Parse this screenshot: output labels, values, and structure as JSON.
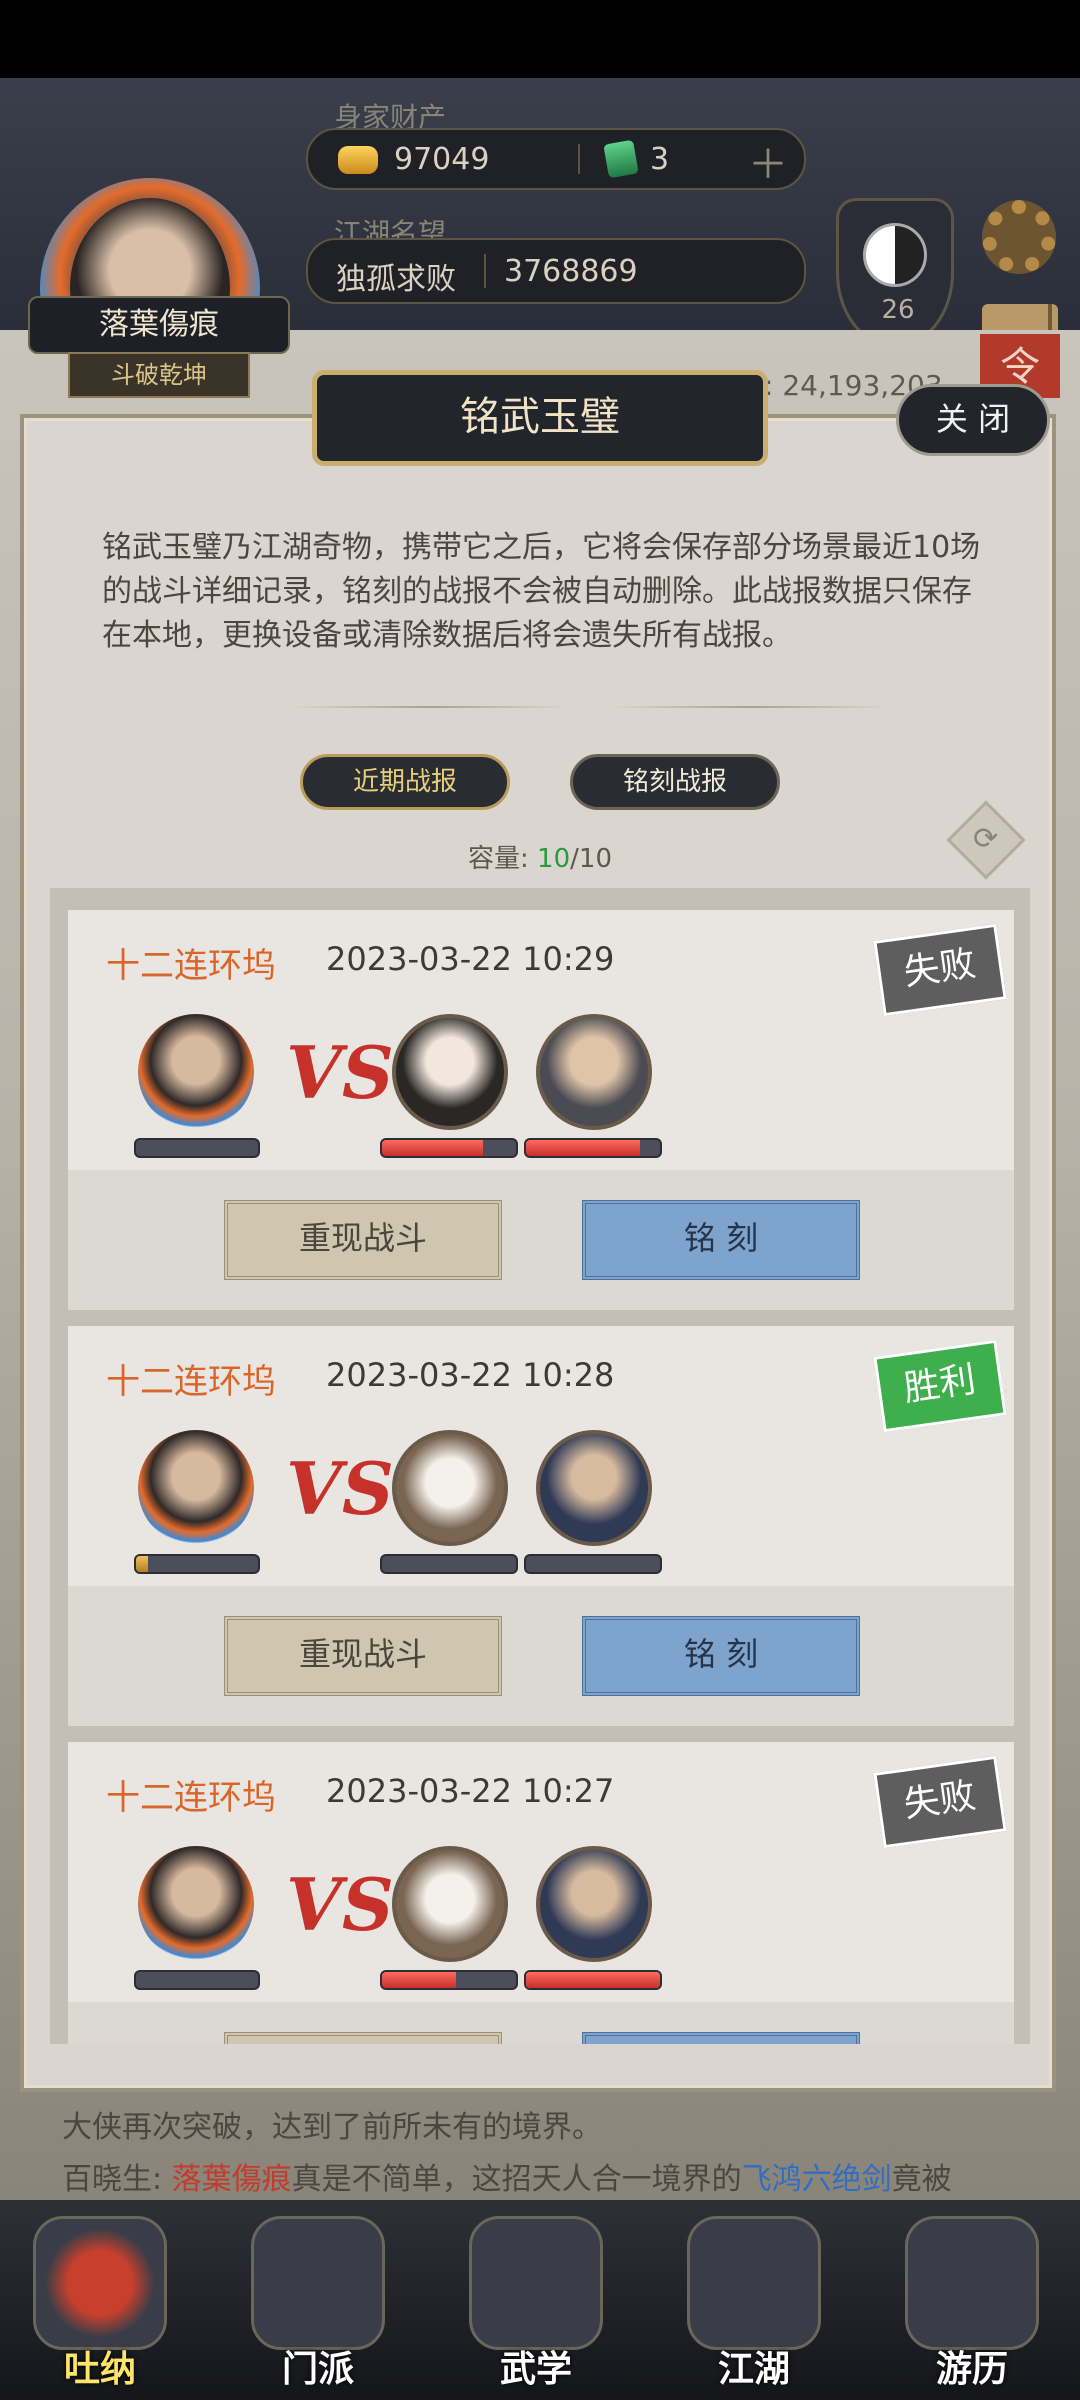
{
  "header": {
    "player_name": "落葉傷痕",
    "player_title": "斗破乾坤",
    "wealth_label": "身家财产",
    "gold": "97049",
    "jade": "3",
    "fame_label": "江湖名望",
    "fame_title": "独孤求败",
    "fame_value": "3768869",
    "level": "26",
    "bg_stat": "性: 24,193,203",
    "corner_tag": "令",
    "gender_symbol": "♂"
  },
  "dialog": {
    "title": "铭武玉璧",
    "close_label": "关 闭",
    "description": "铭武玉璧乃江湖奇物，携带它之后，它将会保存部分场景最近10场的战斗详细记录，铭刻的战报不会被自动删除。此战报数据只保存在本地，更换设备或清除数据后将会遗失所有战报。",
    "tabs": [
      {
        "label": "近期战报",
        "active": true
      },
      {
        "label": "铭刻战报",
        "active": false
      }
    ],
    "capacity_label": "容量: ",
    "capacity_used": "10",
    "capacity_total": "/10",
    "vs_label": "VS",
    "replay_label": "重现战斗",
    "engrave_label": "铭 刻"
  },
  "battles": [
    {
      "location": "十二连环坞",
      "time": "2023-03-22 10:29",
      "result": "失败",
      "result_color": "#5e5e5e",
      "player_hp": 0,
      "enemy_hp": [
        0.75,
        0.85
      ]
    },
    {
      "location": "十二连环坞",
      "time": "2023-03-22 10:28",
      "result": "胜利",
      "result_color": "#3fae4c",
      "player_hp": 0.1,
      "enemy_hp": [
        0,
        0
      ]
    },
    {
      "location": "十二连环坞",
      "time": "2023-03-22 10:27",
      "result": "失败",
      "result_color": "#5e5e5e",
      "player_hp": 0,
      "enemy_hp": [
        0.55,
        1.0
      ]
    }
  ],
  "chat": {
    "line1": "大侠再次突破，达到了前所未有的境界。",
    "speaker": "百晓生: ",
    "name": "落葉傷痕",
    "mid": "真是不简单，这招天人合一境界的",
    "skill": "飞鸿六绝剑",
    "end": "竟被"
  },
  "nav": [
    {
      "label": "吐纳",
      "icon": "meditation-icon",
      "selected": true
    },
    {
      "label": "门派",
      "icon": "sect-icon",
      "selected": false
    },
    {
      "label": "武学",
      "icon": "martial-arts-icon",
      "selected": false
    },
    {
      "label": "江湖",
      "icon": "jianghu-icon",
      "selected": false
    },
    {
      "label": "游历",
      "icon": "travel-icon",
      "selected": false
    }
  ]
}
